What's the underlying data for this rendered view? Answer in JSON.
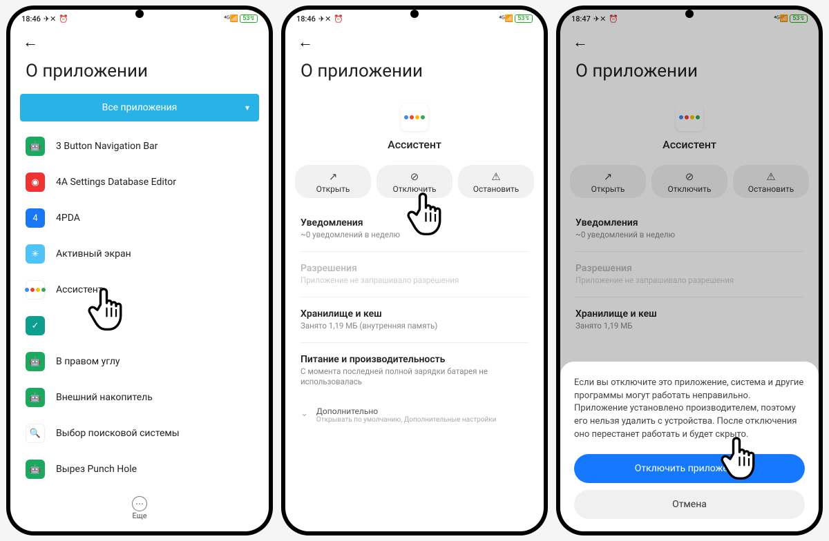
{
  "screen1": {
    "time": "18:46",
    "title": "О приложении",
    "filter": "Все приложения",
    "apps": [
      "3 Button Navigation Bar",
      "4A Settings Database Editor",
      "4PDA",
      "Активный экран",
      "Ассистент",
      "",
      "В правом углу",
      "Внешний накопитель",
      "Выбор поисковой системы",
      "Вырез Punch Hole"
    ],
    "more": "Еще"
  },
  "screen2": {
    "time": "18:46",
    "title": "О приложении",
    "app_name": "Ассистент",
    "actions": {
      "open": "Открыть",
      "disable": "Отключить",
      "stop": "Остановить"
    },
    "notif_t": "Уведомления",
    "notif_s": "~0 уведомлений в неделю",
    "perm_t": "Разрешения",
    "perm_s": "Приложение не запрашивало разрешения",
    "store_t": "Хранилище и кеш",
    "store_s": "Занято 1,19 МБ (внутренняя память)",
    "power_t": "Питание и производительность",
    "power_s": "С момента последней полной зарядки батарея не использовалась",
    "extra_t": "Дополнительно",
    "extra_s": "Открывать по умолчанию, Дополнительные настройки"
  },
  "screen3": {
    "time": "18:47",
    "title": "О приложении",
    "app_name": "Ассистент",
    "actions": {
      "open": "Открыть",
      "disable": "Отключить",
      "stop": "Остановить"
    },
    "notif_t": "Уведомления",
    "notif_s": "~0 уведомлений в неделю",
    "perm_t": "Разрешения",
    "perm_s": "Приложение не запрашивало разрешения",
    "store_t": "Хранилище и кеш",
    "store_s": "Занято 1,19 МБ",
    "modal_text": "Если вы отключите это приложение, система и другие программы могут работать неправильно. Приложение установлено производителем, поэтому его нельзя удалить с устройства. После отключения оно перестанет работать и будет скрыто.",
    "modal_primary": "Отключить приложение",
    "modal_cancel": "Отмена"
  },
  "status_icons": {
    "battery": "53"
  }
}
